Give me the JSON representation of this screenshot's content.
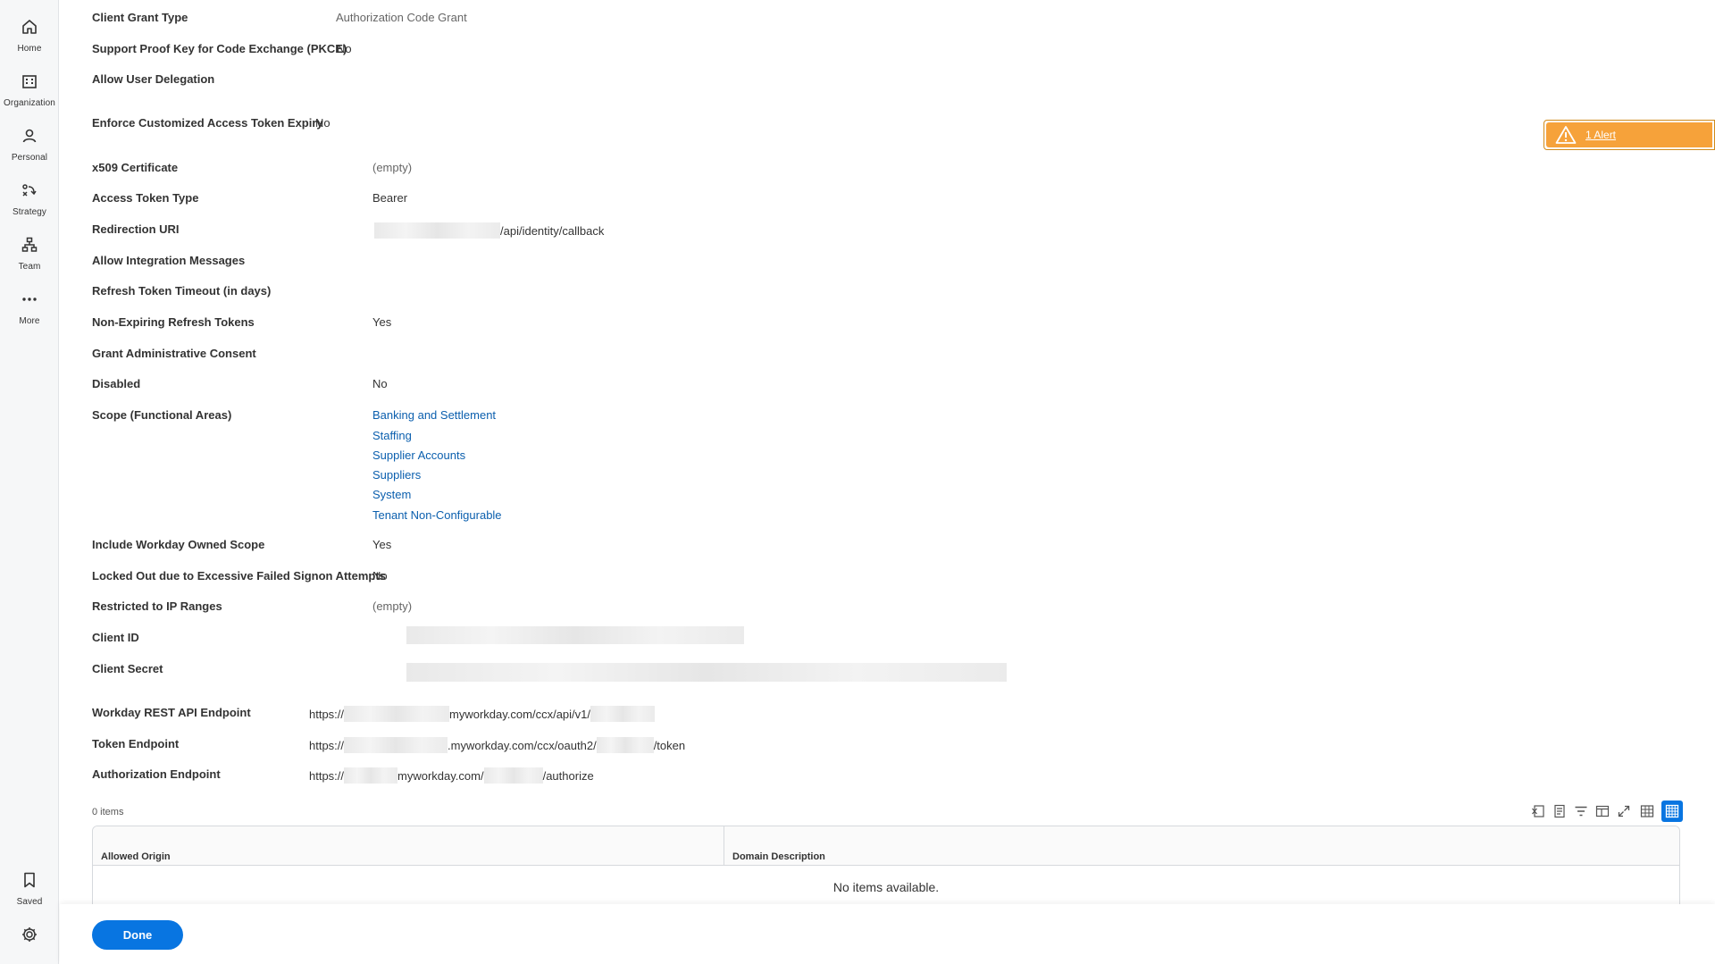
{
  "nav": {
    "home": "Home",
    "organization": "Organization",
    "personal": "Personal",
    "strategy": "Strategy",
    "team": "Team",
    "more": "More",
    "saved": "Saved"
  },
  "alert": {
    "label": "1 Alert"
  },
  "fields": {
    "grant_type": {
      "label": "Client Grant Type",
      "value": "Authorization Code Grant"
    },
    "pkce": {
      "label": "Support Proof Key for Code Exchange (PKCE)",
      "value": "No"
    },
    "user_delegation": {
      "label": "Allow User Delegation"
    },
    "token_expiry": {
      "label": "Enforce Customized Access Token Expiry",
      "value": "No"
    },
    "x509": {
      "label": "x509 Certificate",
      "value": "(empty)"
    },
    "token_type": {
      "label": "Access Token Type",
      "value": "Bearer"
    },
    "redirect_uri": {
      "label": "Redirection URI",
      "suffix": "/api/identity/callback"
    },
    "integration_messages": {
      "label": "Allow Integration Messages"
    },
    "refresh_timeout": {
      "label": "Refresh Token Timeout (in days)"
    },
    "non_expiring": {
      "label": "Non-Expiring Refresh Tokens",
      "value": "Yes"
    },
    "admin_consent": {
      "label": "Grant Administrative Consent"
    },
    "disabled": {
      "label": "Disabled",
      "value": "No"
    },
    "scope": {
      "label": "Scope (Functional Areas)",
      "items": [
        "Banking and Settlement",
        "Staffing",
        "Supplier Accounts",
        "Suppliers",
        "System",
        "Tenant Non-Configurable"
      ]
    },
    "workday_scope": {
      "label": "Include Workday Owned Scope",
      "value": "Yes"
    },
    "locked_out": {
      "label": "Locked Out due to Excessive Failed Signon Attempts",
      "value": "No"
    },
    "ip_ranges": {
      "label": "Restricted to IP Ranges",
      "value": "(empty)"
    },
    "client_id": {
      "label": "Client ID"
    },
    "client_secret": {
      "label": "Client Secret"
    },
    "rest_endpoint": {
      "label": "Workday REST API Endpoint",
      "prefix": "https://",
      "middle": "myworkday.com/ccx/api/v1/"
    },
    "token_endpoint": {
      "label": "Token Endpoint",
      "prefix": "https://",
      "middle": ".myworkday.com/ccx/oauth2/",
      "suffix": "/token"
    },
    "auth_endpoint": {
      "label": "Authorization Endpoint",
      "prefix": "https://",
      "middle": "myworkday.com/",
      "suffix": "/authorize"
    }
  },
  "grid": {
    "count": "0 items",
    "columns": [
      "Allowed Origin",
      "Domain Description"
    ],
    "empty": "No items available."
  },
  "footer": {
    "done": "Done"
  },
  "colors": {
    "primary": "#0875e1",
    "alert": "#f6a23a",
    "link": "#0b5fae"
  }
}
